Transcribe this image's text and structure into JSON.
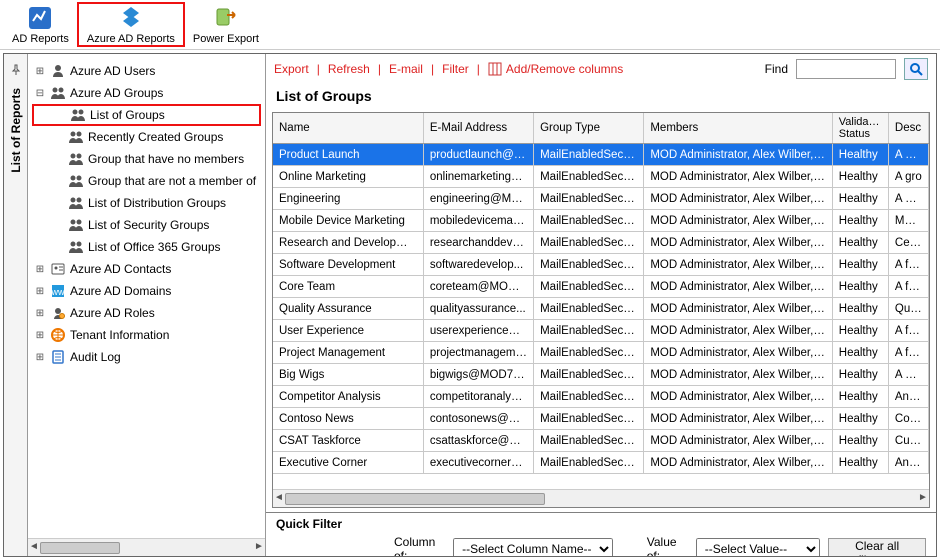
{
  "ribbon": {
    "items": [
      {
        "label": "AD Reports",
        "icon": "ad-reports-icon",
        "highlighted": false
      },
      {
        "label": "Azure AD Reports",
        "icon": "azure-ad-reports-icon",
        "highlighted": true
      },
      {
        "label": "Power Export",
        "icon": "power-export-icon",
        "highlighted": false
      }
    ]
  },
  "sidebar": {
    "tab_label": "List of Reports",
    "items": [
      {
        "label": "Azure AD Users",
        "level": 0,
        "expander": "+",
        "icon": "user-icon",
        "selected": false
      },
      {
        "label": "Azure AD Groups",
        "level": 0,
        "expander": "-",
        "icon": "group-icon",
        "selected": false
      },
      {
        "label": "List of Groups",
        "level": 1,
        "expander": "",
        "icon": "group-icon",
        "selected": true
      },
      {
        "label": "Recently Created Groups",
        "level": 1,
        "expander": "",
        "icon": "group-icon",
        "selected": false
      },
      {
        "label": "Group that have no members",
        "level": 1,
        "expander": "",
        "icon": "group-icon",
        "selected": false
      },
      {
        "label": "Group that are not a member of",
        "level": 1,
        "expander": "",
        "icon": "group-icon",
        "selected": false
      },
      {
        "label": "List of Distribution Groups",
        "level": 1,
        "expander": "",
        "icon": "group-icon",
        "selected": false
      },
      {
        "label": "List of Security Groups",
        "level": 1,
        "expander": "",
        "icon": "group-icon",
        "selected": false
      },
      {
        "label": "List of Office 365 Groups",
        "level": 1,
        "expander": "",
        "icon": "group-icon",
        "selected": false
      },
      {
        "label": "Azure AD Contacts",
        "level": 0,
        "expander": "+",
        "icon": "contact-icon",
        "selected": false
      },
      {
        "label": "Azure AD Domains",
        "level": 0,
        "expander": "+",
        "icon": "domain-icon",
        "selected": false
      },
      {
        "label": "Azure AD Roles",
        "level": 0,
        "expander": "+",
        "icon": "role-icon",
        "selected": false
      },
      {
        "label": "Tenant Information",
        "level": 0,
        "expander": "+",
        "icon": "tenant-icon",
        "selected": false
      },
      {
        "label": "Audit Log",
        "level": 0,
        "expander": "+",
        "icon": "audit-icon",
        "selected": false
      }
    ]
  },
  "toolbar": {
    "export": "Export",
    "refresh": "Refresh",
    "email": "E-mail",
    "filter": "Filter",
    "addremove": "Add/Remove columns",
    "find_label": "Find",
    "find_value": ""
  },
  "content": {
    "title": "List of Groups",
    "columns": [
      "Name",
      "E-Mail Address",
      "Group Type",
      "Members",
      "Validation Status",
      "Desc"
    ],
    "rows": [
      {
        "name": "Product Launch",
        "email": "productlaunch@M...",
        "type": "MailEnabledSecurity",
        "members": "MOD Administrator, Alex Wilber, Patt...",
        "status": "Healthy",
        "desc": "A coll",
        "selected": true
      },
      {
        "name": "Online Marketing",
        "email": "onlinemarketing@...",
        "type": "MailEnabledSecurity",
        "members": "MOD Administrator, Alex Wilber, De...",
        "status": "Healthy",
        "desc": "A gro"
      },
      {
        "name": "Engineering",
        "email": "engineering@MOD...",
        "type": "MailEnabledSecurity",
        "members": "MOD Administrator, Alex Wilber, Patt...",
        "status": "Healthy",
        "desc": "A colla"
      },
      {
        "name": "Mobile Device Marketing",
        "email": "mobiledevicemark...",
        "type": "MailEnabledSecurity",
        "members": "MOD Administrator, Alex Wilber, De...",
        "status": "Healthy",
        "desc": "Mobile"
      },
      {
        "name": "Research and Development",
        "email": "researchanddevel...",
        "type": "MailEnabledSecurity",
        "members": "MOD Administrator, Alex Wilber, De...",
        "status": "Healthy",
        "desc": "Centra"
      },
      {
        "name": "Software Development",
        "email": "softwaredevelop...",
        "type": "MailEnabledSecurity",
        "members": "MOD Administrator, Alex Wilber, De...",
        "status": "Healthy",
        "desc": "A foru"
      },
      {
        "name": "Core Team",
        "email": "coreteam@MOD7...",
        "type": "MailEnabledSecurity",
        "members": "MOD Administrator, Alex Wilber, De...",
        "status": "Healthy",
        "desc": "A foru"
      },
      {
        "name": "Quality Assurance",
        "email": "qualityassurance...",
        "type": "MailEnabledSecurity",
        "members": "MOD Administrator, Alex Wilber, Alla...",
        "status": "Healthy",
        "desc": "Qualit"
      },
      {
        "name": "User Experience",
        "email": "userexperience@...",
        "type": "MailEnabledSecurity",
        "members": "MOD Administrator, Alex Wilber, Alla...",
        "status": "Healthy",
        "desc": "A foru"
      },
      {
        "name": "Project Management",
        "email": "projectmanageme...",
        "type": "MailEnabledSecurity",
        "members": "MOD Administrator, Alex Wilber, De...",
        "status": "Healthy",
        "desc": "A foru"
      },
      {
        "name": "Big Wigs",
        "email": "bigwigs@MOD799...",
        "type": "MailEnabledSecurity",
        "members": "MOD Administrator, Alex Wilber, Patt...",
        "status": "Healthy",
        "desc": "A cas"
      },
      {
        "name": "Competitor Analysis",
        "email": "competitoranalysi...",
        "type": "MailEnabledSecurity",
        "members": "MOD Administrator, Alex Wilber, De...",
        "status": "Healthy",
        "desc": "An as"
      },
      {
        "name": "Contoso News",
        "email": "contosonews@M...",
        "type": "MailEnabledSecurity",
        "members": "MOD Administrator, Alex Wilber, De...",
        "status": "Healthy",
        "desc": "Comp"
      },
      {
        "name": "CSAT Taskforce",
        "email": "csattaskforce@M...",
        "type": "MailEnabledSecurity",
        "members": "MOD Administrator, Alex Wilber, Jon...",
        "status": "Healthy",
        "desc": "Custo"
      },
      {
        "name": "Executive Corner",
        "email": "executivecorner@...",
        "type": "MailEnabledSecurity",
        "members": "MOD Administrator, Alex Wilber, De...",
        "status": "Healthy",
        "desc": "An op"
      }
    ]
  },
  "quickfilter": {
    "title": "Quick Filter",
    "column_label": "Column of:",
    "column_value": "--Select Column Name--",
    "value_label": "Value of:",
    "value_value": "--Select Value--",
    "clear_label": "Clear all filters..."
  }
}
